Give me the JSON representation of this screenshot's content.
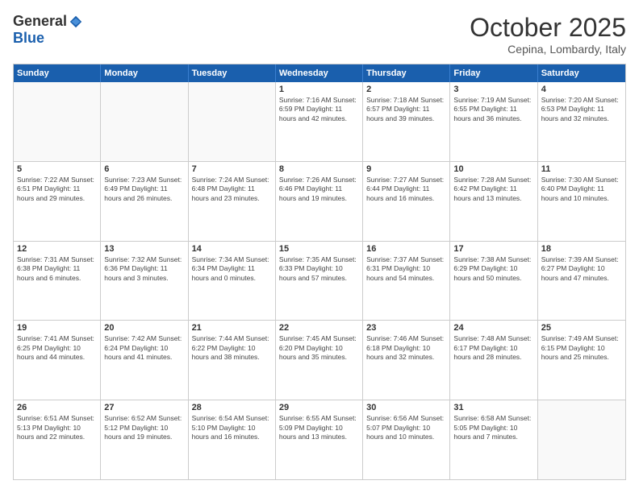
{
  "logo": {
    "general": "General",
    "blue": "Blue"
  },
  "header": {
    "month": "October 2025",
    "location": "Cepina, Lombardy, Italy"
  },
  "weekdays": [
    "Sunday",
    "Monday",
    "Tuesday",
    "Wednesday",
    "Thursday",
    "Friday",
    "Saturday"
  ],
  "rows": [
    [
      {
        "day": "",
        "info": ""
      },
      {
        "day": "",
        "info": ""
      },
      {
        "day": "",
        "info": ""
      },
      {
        "day": "1",
        "info": "Sunrise: 7:16 AM\nSunset: 6:59 PM\nDaylight: 11 hours and 42 minutes."
      },
      {
        "day": "2",
        "info": "Sunrise: 7:18 AM\nSunset: 6:57 PM\nDaylight: 11 hours and 39 minutes."
      },
      {
        "day": "3",
        "info": "Sunrise: 7:19 AM\nSunset: 6:55 PM\nDaylight: 11 hours and 36 minutes."
      },
      {
        "day": "4",
        "info": "Sunrise: 7:20 AM\nSunset: 6:53 PM\nDaylight: 11 hours and 32 minutes."
      }
    ],
    [
      {
        "day": "5",
        "info": "Sunrise: 7:22 AM\nSunset: 6:51 PM\nDaylight: 11 hours and 29 minutes."
      },
      {
        "day": "6",
        "info": "Sunrise: 7:23 AM\nSunset: 6:49 PM\nDaylight: 11 hours and 26 minutes."
      },
      {
        "day": "7",
        "info": "Sunrise: 7:24 AM\nSunset: 6:48 PM\nDaylight: 11 hours and 23 minutes."
      },
      {
        "day": "8",
        "info": "Sunrise: 7:26 AM\nSunset: 6:46 PM\nDaylight: 11 hours and 19 minutes."
      },
      {
        "day": "9",
        "info": "Sunrise: 7:27 AM\nSunset: 6:44 PM\nDaylight: 11 hours and 16 minutes."
      },
      {
        "day": "10",
        "info": "Sunrise: 7:28 AM\nSunset: 6:42 PM\nDaylight: 11 hours and 13 minutes."
      },
      {
        "day": "11",
        "info": "Sunrise: 7:30 AM\nSunset: 6:40 PM\nDaylight: 11 hours and 10 minutes."
      }
    ],
    [
      {
        "day": "12",
        "info": "Sunrise: 7:31 AM\nSunset: 6:38 PM\nDaylight: 11 hours and 6 minutes."
      },
      {
        "day": "13",
        "info": "Sunrise: 7:32 AM\nSunset: 6:36 PM\nDaylight: 11 hours and 3 minutes."
      },
      {
        "day": "14",
        "info": "Sunrise: 7:34 AM\nSunset: 6:34 PM\nDaylight: 11 hours and 0 minutes."
      },
      {
        "day": "15",
        "info": "Sunrise: 7:35 AM\nSunset: 6:33 PM\nDaylight: 10 hours and 57 minutes."
      },
      {
        "day": "16",
        "info": "Sunrise: 7:37 AM\nSunset: 6:31 PM\nDaylight: 10 hours and 54 minutes."
      },
      {
        "day": "17",
        "info": "Sunrise: 7:38 AM\nSunset: 6:29 PM\nDaylight: 10 hours and 50 minutes."
      },
      {
        "day": "18",
        "info": "Sunrise: 7:39 AM\nSunset: 6:27 PM\nDaylight: 10 hours and 47 minutes."
      }
    ],
    [
      {
        "day": "19",
        "info": "Sunrise: 7:41 AM\nSunset: 6:25 PM\nDaylight: 10 hours and 44 minutes."
      },
      {
        "day": "20",
        "info": "Sunrise: 7:42 AM\nSunset: 6:24 PM\nDaylight: 10 hours and 41 minutes."
      },
      {
        "day": "21",
        "info": "Sunrise: 7:44 AM\nSunset: 6:22 PM\nDaylight: 10 hours and 38 minutes."
      },
      {
        "day": "22",
        "info": "Sunrise: 7:45 AM\nSunset: 6:20 PM\nDaylight: 10 hours and 35 minutes."
      },
      {
        "day": "23",
        "info": "Sunrise: 7:46 AM\nSunset: 6:18 PM\nDaylight: 10 hours and 32 minutes."
      },
      {
        "day": "24",
        "info": "Sunrise: 7:48 AM\nSunset: 6:17 PM\nDaylight: 10 hours and 28 minutes."
      },
      {
        "day": "25",
        "info": "Sunrise: 7:49 AM\nSunset: 6:15 PM\nDaylight: 10 hours and 25 minutes."
      }
    ],
    [
      {
        "day": "26",
        "info": "Sunrise: 6:51 AM\nSunset: 5:13 PM\nDaylight: 10 hours and 22 minutes."
      },
      {
        "day": "27",
        "info": "Sunrise: 6:52 AM\nSunset: 5:12 PM\nDaylight: 10 hours and 19 minutes."
      },
      {
        "day": "28",
        "info": "Sunrise: 6:54 AM\nSunset: 5:10 PM\nDaylight: 10 hours and 16 minutes."
      },
      {
        "day": "29",
        "info": "Sunrise: 6:55 AM\nSunset: 5:09 PM\nDaylight: 10 hours and 13 minutes."
      },
      {
        "day": "30",
        "info": "Sunrise: 6:56 AM\nSunset: 5:07 PM\nDaylight: 10 hours and 10 minutes."
      },
      {
        "day": "31",
        "info": "Sunrise: 6:58 AM\nSunset: 5:05 PM\nDaylight: 10 hours and 7 minutes."
      },
      {
        "day": "",
        "info": ""
      }
    ]
  ]
}
